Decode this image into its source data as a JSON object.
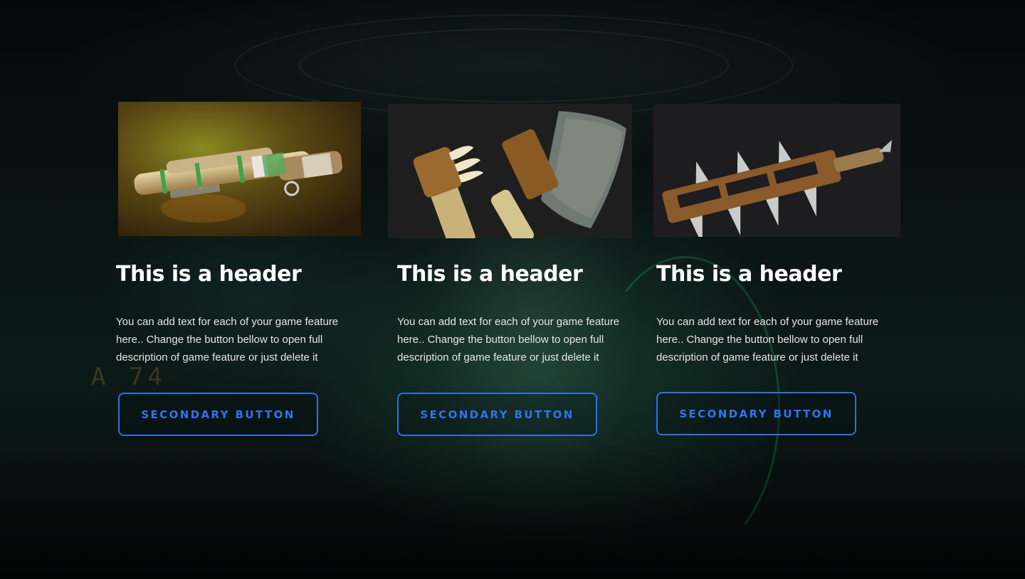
{
  "features": [
    {
      "header": "This is a header",
      "description": "You can add text for each of your game feature here.. Change the button bellow to open full description of game feature or just delete it",
      "button_label": "SECONDARY BUTTON",
      "image_icon": "bamboo-pistol-image"
    },
    {
      "header": "This is a header",
      "description": "You can add text for each of your game feature here.. Change the button bellow to open full description of game feature or just delete it",
      "button_label": "SECONDARY BUTTON",
      "image_icon": "bone-cleaver-image"
    },
    {
      "header": "This is a header",
      "description": "You can add text for each of your game feature here.. Change the button bellow to open full description of game feature or just delete it",
      "button_label": "SECONDARY BUTTON",
      "image_icon": "spiked-sword-image"
    }
  ],
  "background": {
    "sign_text": "A 74"
  },
  "colors": {
    "accent": "#2f6fe8",
    "heading": "#ffffff",
    "body_text": "#e6e6e6",
    "background": "#070b0c"
  }
}
